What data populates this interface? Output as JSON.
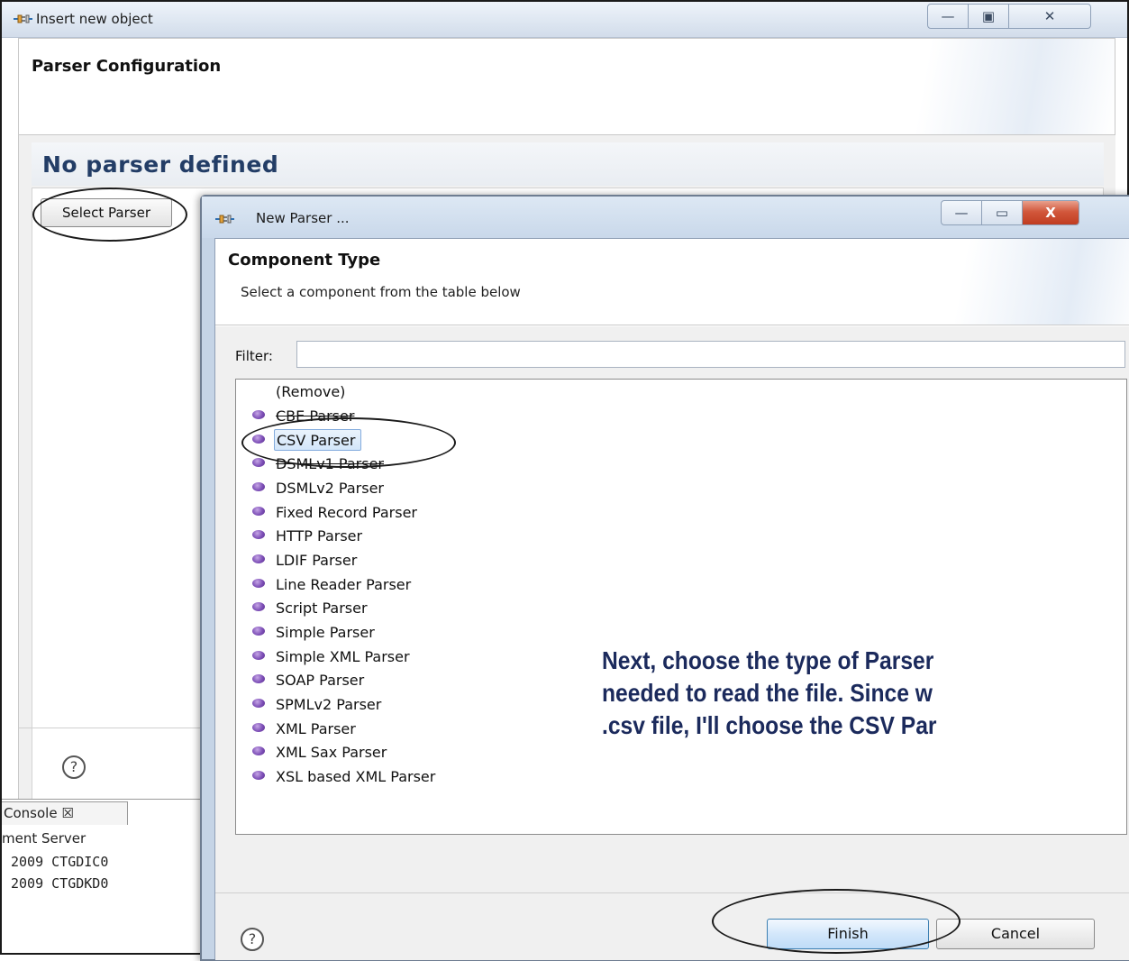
{
  "outer_window": {
    "title": "Insert new object",
    "icon": "parser-plug-icon",
    "header_title": "Parser Configuration",
    "status_heading": "No parser defined",
    "select_parser_label": "Select Parser",
    "help_symbol": "?"
  },
  "console": {
    "tab_label": "Console ☒",
    "server_label": "ment Server",
    "lines": [
      "2009 CTGDIC0",
      "2009 CTGDKD0"
    ]
  },
  "dialog": {
    "title": "New Parser ...",
    "icon": "parser-plug-icon",
    "window_buttons": {
      "minimize": "—",
      "maximize": "▭",
      "close": "X"
    },
    "header_title": "Component Type",
    "header_subtitle": "Select a component from the table below",
    "filter_label": "Filter:",
    "filter_value": "",
    "items": [
      {
        "label": "(Remove)"
      },
      {
        "label": "CBE Parser"
      },
      {
        "label": "CSV Parser"
      },
      {
        "label": "DSMLv1 Parser"
      },
      {
        "label": "DSMLv2 Parser"
      },
      {
        "label": "Fixed Record Parser"
      },
      {
        "label": "HTTP Parser"
      },
      {
        "label": "LDIF Parser"
      },
      {
        "label": "Line Reader Parser"
      },
      {
        "label": "Script Parser"
      },
      {
        "label": "Simple Parser"
      },
      {
        "label": "Simple XML Parser"
      },
      {
        "label": "SOAP Parser"
      },
      {
        "label": "SPMLv2 Parser"
      },
      {
        "label": "XML Parser"
      },
      {
        "label": "XML Sax Parser"
      },
      {
        "label": "XSL based XML Parser"
      }
    ],
    "selected_item": "CSV Parser",
    "finish_label": "Finish",
    "cancel_label": "Cancel",
    "help_symbol": "?"
  },
  "annotation": {
    "lines": [
      "Next, choose the type of Parser",
      "needed to read the file. Since w",
      ".csv file, I'll choose the CSV Par"
    ]
  },
  "colors": {
    "heading_blue": "#233d66",
    "annotation_text": "#1b2a5c",
    "bullet_purple": "#7d4fb7",
    "selection_border": "#84acdd"
  }
}
